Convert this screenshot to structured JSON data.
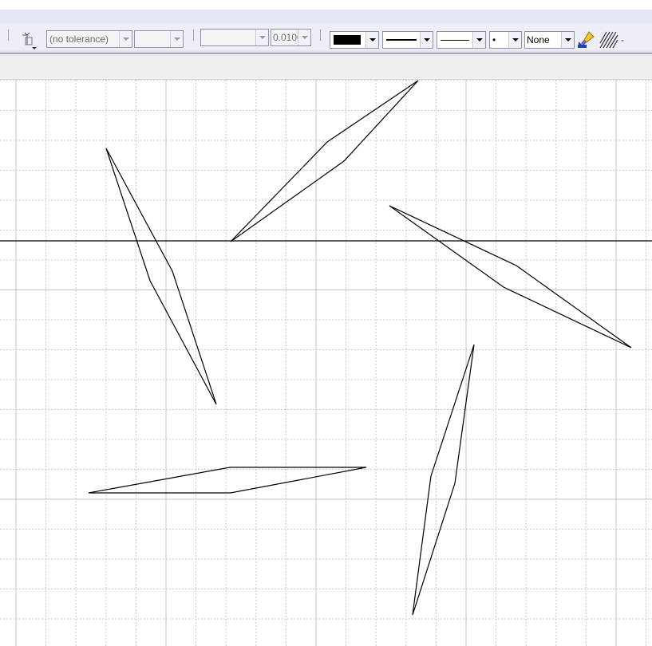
{
  "toolbar": {
    "tolerance": {
      "value": "(no tolerance)"
    },
    "blank_combo_1": {
      "value": ""
    },
    "blank_combo_2": {
      "value": ""
    },
    "precision": {
      "value": "0.0100"
    },
    "fill_color": {
      "color": "#000000"
    },
    "line_style": {
      "value": ""
    },
    "line_weight": {
      "value": ""
    },
    "point_style": {
      "value": "•"
    },
    "pattern": {
      "value": "None"
    },
    "icons": [
      "select-arrow-icon",
      "paintbrush-icon",
      "hatch-pattern-icon"
    ]
  },
  "canvas": {
    "grid": true,
    "axis_color": "#000000",
    "grid_color": "#c8c8c8",
    "shapes": [
      "blade-top",
      "blade-left",
      "blade-right",
      "blade-bottom-right",
      "blade-bottom-left"
    ]
  }
}
